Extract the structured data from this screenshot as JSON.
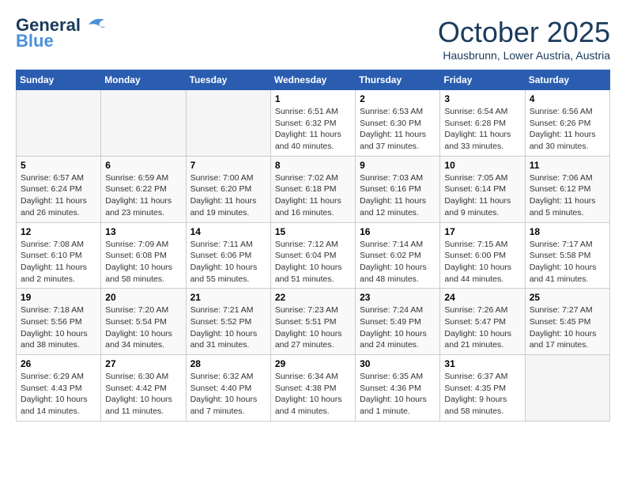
{
  "header": {
    "logo_line1": "General",
    "logo_line2": "Blue",
    "month": "October 2025",
    "location": "Hausbrunn, Lower Austria, Austria"
  },
  "weekdays": [
    "Sunday",
    "Monday",
    "Tuesday",
    "Wednesday",
    "Thursday",
    "Friday",
    "Saturday"
  ],
  "weeks": [
    [
      {
        "day": "",
        "info": ""
      },
      {
        "day": "",
        "info": ""
      },
      {
        "day": "",
        "info": ""
      },
      {
        "day": "1",
        "info": "Sunrise: 6:51 AM\nSunset: 6:32 PM\nDaylight: 11 hours\nand 40 minutes."
      },
      {
        "day": "2",
        "info": "Sunrise: 6:53 AM\nSunset: 6:30 PM\nDaylight: 11 hours\nand 37 minutes."
      },
      {
        "day": "3",
        "info": "Sunrise: 6:54 AM\nSunset: 6:28 PM\nDaylight: 11 hours\nand 33 minutes."
      },
      {
        "day": "4",
        "info": "Sunrise: 6:56 AM\nSunset: 6:26 PM\nDaylight: 11 hours\nand 30 minutes."
      }
    ],
    [
      {
        "day": "5",
        "info": "Sunrise: 6:57 AM\nSunset: 6:24 PM\nDaylight: 11 hours\nand 26 minutes."
      },
      {
        "day": "6",
        "info": "Sunrise: 6:59 AM\nSunset: 6:22 PM\nDaylight: 11 hours\nand 23 minutes."
      },
      {
        "day": "7",
        "info": "Sunrise: 7:00 AM\nSunset: 6:20 PM\nDaylight: 11 hours\nand 19 minutes."
      },
      {
        "day": "8",
        "info": "Sunrise: 7:02 AM\nSunset: 6:18 PM\nDaylight: 11 hours\nand 16 minutes."
      },
      {
        "day": "9",
        "info": "Sunrise: 7:03 AM\nSunset: 6:16 PM\nDaylight: 11 hours\nand 12 minutes."
      },
      {
        "day": "10",
        "info": "Sunrise: 7:05 AM\nSunset: 6:14 PM\nDaylight: 11 hours\nand 9 minutes."
      },
      {
        "day": "11",
        "info": "Sunrise: 7:06 AM\nSunset: 6:12 PM\nDaylight: 11 hours\nand 5 minutes."
      }
    ],
    [
      {
        "day": "12",
        "info": "Sunrise: 7:08 AM\nSunset: 6:10 PM\nDaylight: 11 hours\nand 2 minutes."
      },
      {
        "day": "13",
        "info": "Sunrise: 7:09 AM\nSunset: 6:08 PM\nDaylight: 10 hours\nand 58 minutes."
      },
      {
        "day": "14",
        "info": "Sunrise: 7:11 AM\nSunset: 6:06 PM\nDaylight: 10 hours\nand 55 minutes."
      },
      {
        "day": "15",
        "info": "Sunrise: 7:12 AM\nSunset: 6:04 PM\nDaylight: 10 hours\nand 51 minutes."
      },
      {
        "day": "16",
        "info": "Sunrise: 7:14 AM\nSunset: 6:02 PM\nDaylight: 10 hours\nand 48 minutes."
      },
      {
        "day": "17",
        "info": "Sunrise: 7:15 AM\nSunset: 6:00 PM\nDaylight: 10 hours\nand 44 minutes."
      },
      {
        "day": "18",
        "info": "Sunrise: 7:17 AM\nSunset: 5:58 PM\nDaylight: 10 hours\nand 41 minutes."
      }
    ],
    [
      {
        "day": "19",
        "info": "Sunrise: 7:18 AM\nSunset: 5:56 PM\nDaylight: 10 hours\nand 38 minutes."
      },
      {
        "day": "20",
        "info": "Sunrise: 7:20 AM\nSunset: 5:54 PM\nDaylight: 10 hours\nand 34 minutes."
      },
      {
        "day": "21",
        "info": "Sunrise: 7:21 AM\nSunset: 5:52 PM\nDaylight: 10 hours\nand 31 minutes."
      },
      {
        "day": "22",
        "info": "Sunrise: 7:23 AM\nSunset: 5:51 PM\nDaylight: 10 hours\nand 27 minutes."
      },
      {
        "day": "23",
        "info": "Sunrise: 7:24 AM\nSunset: 5:49 PM\nDaylight: 10 hours\nand 24 minutes."
      },
      {
        "day": "24",
        "info": "Sunrise: 7:26 AM\nSunset: 5:47 PM\nDaylight: 10 hours\nand 21 minutes."
      },
      {
        "day": "25",
        "info": "Sunrise: 7:27 AM\nSunset: 5:45 PM\nDaylight: 10 hours\nand 17 minutes."
      }
    ],
    [
      {
        "day": "26",
        "info": "Sunrise: 6:29 AM\nSunset: 4:43 PM\nDaylight: 10 hours\nand 14 minutes."
      },
      {
        "day": "27",
        "info": "Sunrise: 6:30 AM\nSunset: 4:42 PM\nDaylight: 10 hours\nand 11 minutes."
      },
      {
        "day": "28",
        "info": "Sunrise: 6:32 AM\nSunset: 4:40 PM\nDaylight: 10 hours\nand 7 minutes."
      },
      {
        "day": "29",
        "info": "Sunrise: 6:34 AM\nSunset: 4:38 PM\nDaylight: 10 hours\nand 4 minutes."
      },
      {
        "day": "30",
        "info": "Sunrise: 6:35 AM\nSunset: 4:36 PM\nDaylight: 10 hours\nand 1 minute."
      },
      {
        "day": "31",
        "info": "Sunrise: 6:37 AM\nSunset: 4:35 PM\nDaylight: 9 hours\nand 58 minutes."
      },
      {
        "day": "",
        "info": ""
      }
    ]
  ]
}
